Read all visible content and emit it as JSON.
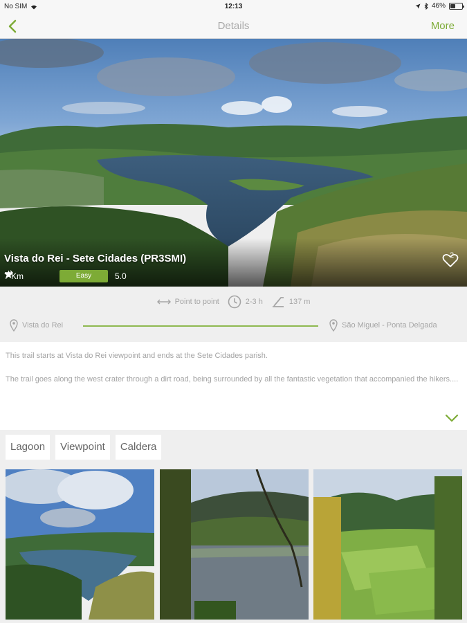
{
  "status_bar": {
    "carrier": "No SIM",
    "time": "12:13",
    "battery_percent": "46%",
    "battery_level": 0.46
  },
  "nav": {
    "title": "Details",
    "more_label": "More",
    "back_icon": "chevron-left-icon"
  },
  "trail": {
    "name": "Vista do Rei - Sete Cidades (PR3SMI)",
    "distance": "7 Km",
    "difficulty": "Easy",
    "rating": "5.0",
    "favorites": "2",
    "type": "Point to point",
    "duration": "2-3 h",
    "elevation": "137 m",
    "start": "Vista do Rei",
    "end": "São Miguel - Ponta Delgada"
  },
  "description": {
    "p1": "This trail starts at Vista do Rei viewpoint and ends at the Sete Cidades parish.",
    "p2": "The trail goes along the west crater through a dirt road, being surrounded by all the fantastic vegetation that accompanied the hikers...."
  },
  "tags": [
    "Lagoon",
    "Viewpoint",
    "Caldera"
  ],
  "colors": {
    "accent": "#7dab36",
    "muted_text": "#a5a5a5",
    "background": "#efefef"
  }
}
